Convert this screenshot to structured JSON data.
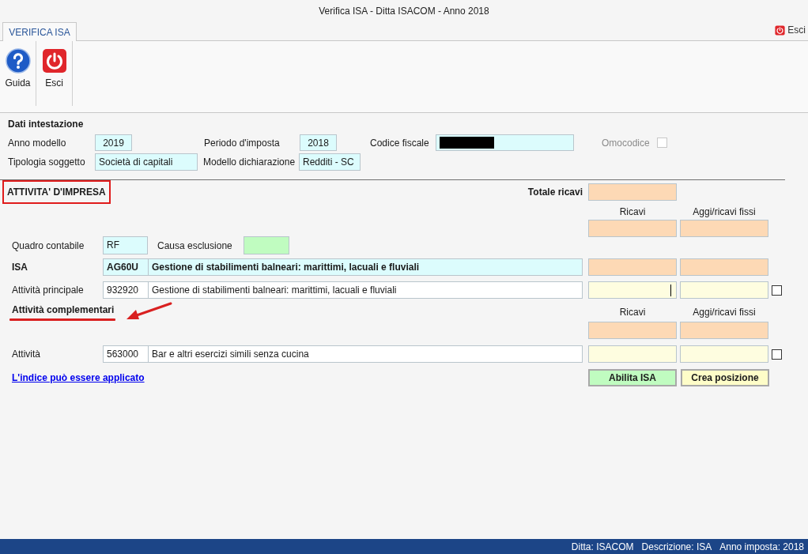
{
  "window": {
    "title": "Verifica ISA - Ditta ISACOM - Anno 2018"
  },
  "tabs": [
    {
      "label": "VERIFICA ISA",
      "selected": true
    }
  ],
  "top_exit": {
    "label": "Esci"
  },
  "ribbon": [
    {
      "kind": "help",
      "label": "Guida"
    },
    {
      "kind": "exit",
      "label": "Esci"
    }
  ],
  "header": {
    "title": "Dati intestazione",
    "anno_modello": {
      "label": "Anno modello",
      "value": "2019"
    },
    "periodo_imposta": {
      "label": "Periodo d'imposta",
      "value": "2018"
    },
    "codice_fiscale": {
      "label": "Codice fiscale",
      "redacted": true
    },
    "omocodice": {
      "label": "Omocodice",
      "checked": false,
      "disabled": true
    },
    "tipologia_soggetto": {
      "label": "Tipologia soggetto",
      "value": "Società di capitali"
    },
    "modello_dichiarazione": {
      "label": "Modello dichiarazione",
      "value": "Redditi - SC"
    }
  },
  "section": {
    "title": "ATTIVITA' D'IMPRESA",
    "highlighted": true
  },
  "totale_ricavi": {
    "label": "Totale ricavi"
  },
  "column_headers": [
    "Ricavi",
    "Aggi/ricavi fissi"
  ],
  "quadro_contabile": {
    "label": "Quadro contabile",
    "value": "RF"
  },
  "causa_esclusione": {
    "label": "Causa esclusione"
  },
  "isa": {
    "label": "ISA",
    "code": "AG60U",
    "description": "Gestione di stabilimenti balneari: marittimi, lacuali e fluviali"
  },
  "attivita_principale": {
    "label": "Attività principale",
    "code": "932920",
    "description": "Gestione di stabilimenti balneari: marittimi, lacuali e fluviali",
    "focused": true,
    "checked": false
  },
  "complementari": {
    "title": "Attività complementari",
    "annotated": true,
    "column_headers": [
      "Ricavi",
      "Aggi/ricavi fissi"
    ],
    "rows": [
      {
        "label": "Attività",
        "code": "563000",
        "description": "Bar e altri esercizi simili senza cucina",
        "checked": false
      }
    ]
  },
  "link": "L'indice può essere applicato",
  "buttons": [
    {
      "kind": "enable",
      "label": "Abilita ISA"
    },
    {
      "kind": "create",
      "label": "Crea posizione"
    }
  ],
  "status_bar": [
    "Ditta: ISACOM",
    "Descrizione: ISA",
    "Anno imposta: 2018"
  ]
}
